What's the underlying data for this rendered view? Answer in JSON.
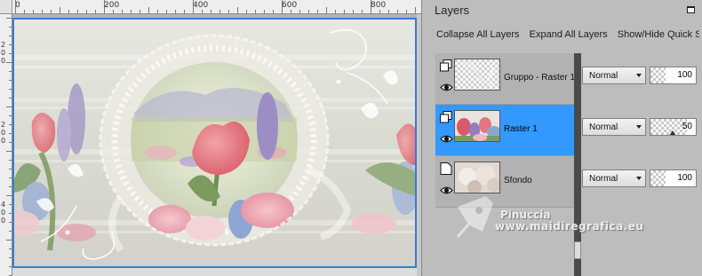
{
  "ruler": {
    "top_labels": [
      "0",
      "200",
      "400",
      "600",
      "800"
    ],
    "left_labels": [
      "2",
      "0",
      "0",
      "2",
      "0",
      "0",
      "4",
      "0",
      "0"
    ]
  },
  "layers_panel": {
    "title": "Layers",
    "toolbar": {
      "collapse_label": "Collapse All Layers",
      "expand_label": "Expand All Layers",
      "showhide_label": "Show/Hide Quick S"
    },
    "layers": [
      {
        "name": "Gruppo - Raster 1",
        "blend_mode": "Normal",
        "opacity": "100",
        "opacity_fraction": 1.0,
        "selected": false
      },
      {
        "name": "Raster 1",
        "blend_mode": "Normal",
        "opacity": "50",
        "opacity_fraction": 0.5,
        "selected": true
      },
      {
        "name": "Sfondo",
        "blend_mode": "Normal",
        "opacity": "100",
        "opacity_fraction": 1.0,
        "selected": false
      }
    ]
  },
  "watermark": {
    "line1": "Pinuccia",
    "line2": "www.maidiregrafica.eu"
  },
  "colors": {
    "selection": "#3399ff",
    "canvas_border": "#3a7bd5",
    "panel_bg": "#bdbdbd"
  }
}
